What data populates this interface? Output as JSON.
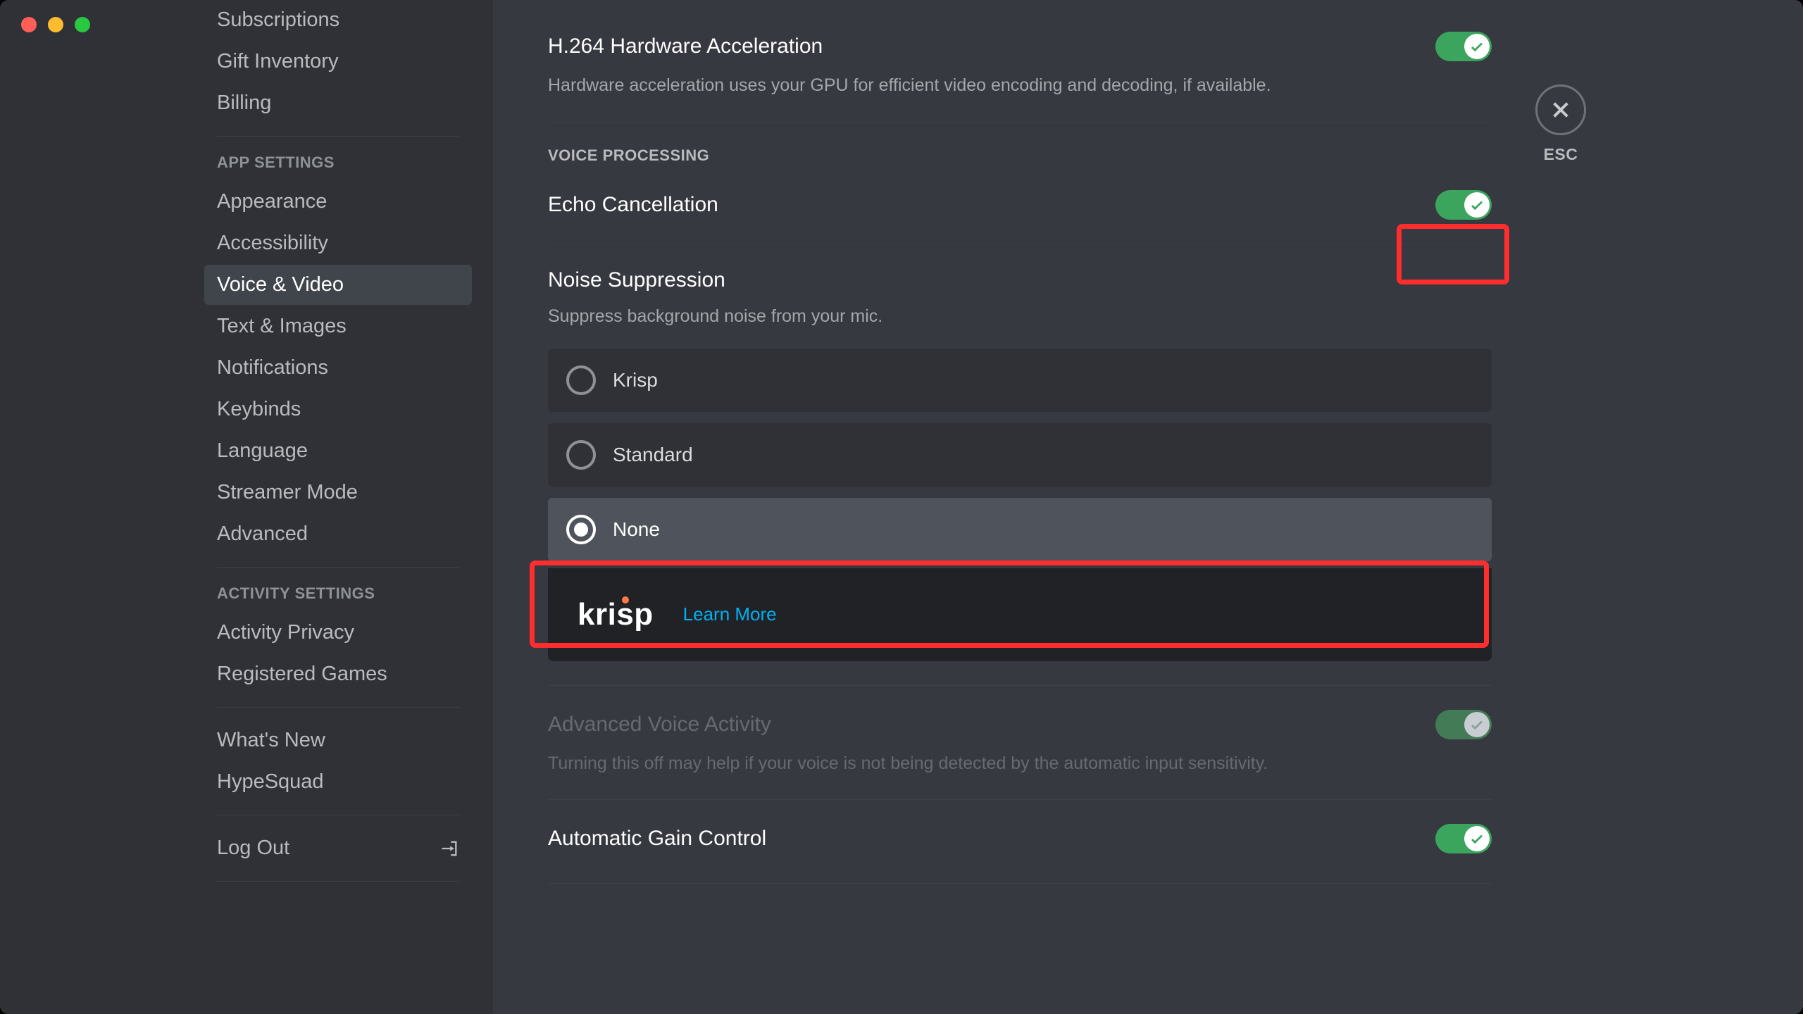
{
  "close": {
    "esc": "ESC"
  },
  "sidebar": {
    "items_above": [
      "Subscriptions",
      "Gift Inventory",
      "Billing"
    ],
    "heading_app": "APP SETTINGS",
    "items_app": [
      "Appearance",
      "Accessibility",
      "Voice & Video",
      "Text & Images",
      "Notifications",
      "Keybinds",
      "Language",
      "Streamer Mode",
      "Advanced"
    ],
    "app_active": 2,
    "heading_activity": "ACTIVITY SETTINGS",
    "items_activity": [
      "Activity Privacy",
      "Registered Games"
    ],
    "items_bottom": [
      "What's New",
      "HypeSquad"
    ],
    "logout": "Log Out"
  },
  "h264": {
    "title": "H.264 Hardware Acceleration",
    "desc": "Hardware acceleration uses your GPU for efficient video encoding and decoding, if available."
  },
  "voice_processing_heading": "VOICE PROCESSING",
  "echo": {
    "title": "Echo Cancellation"
  },
  "noise": {
    "title": "Noise Suppression",
    "desc": "Suppress background noise from your mic.",
    "options": [
      "Krisp",
      "Standard",
      "None"
    ],
    "selected": 2
  },
  "krisp": {
    "logo_text": "krisp",
    "link": "Learn More"
  },
  "ava": {
    "title": "Advanced Voice Activity",
    "desc": "Turning this off may help if your voice is not being detected by the automatic input sensitivity."
  },
  "agc": {
    "title": "Automatic Gain Control"
  }
}
